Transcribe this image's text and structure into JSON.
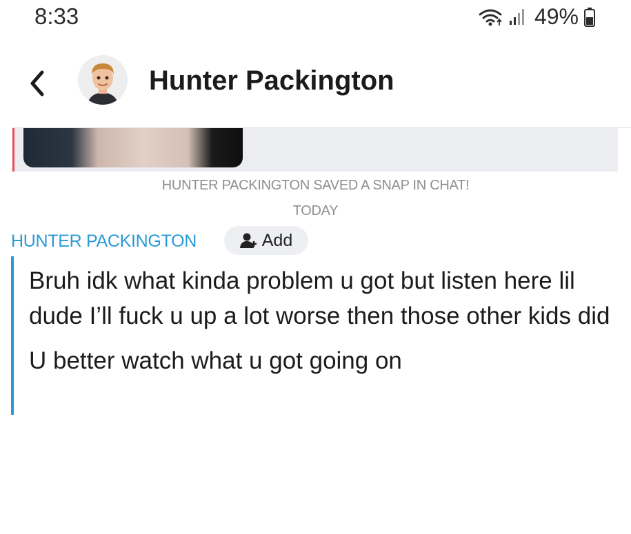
{
  "status_bar": {
    "time": "8:33",
    "battery": "49%",
    "icons": [
      "wifi-icon",
      "signal-icon",
      "battery-icon"
    ]
  },
  "header": {
    "back_icon": "chevron-left-icon",
    "contact_name": "Hunter Packington"
  },
  "chat": {
    "saved_notice": "HUNTER PACKINGTON SAVED A SNAP IN CHAT!",
    "date_separator": "TODAY",
    "sender_label": "HUNTER PACKINGTON",
    "add_button_label": "Add",
    "messages": [
      "Bruh idk what kinda problem u got but listen here lil dude I’ll fuck u up a lot worse then those other kids did",
      "U better watch what u got going on"
    ]
  },
  "colors": {
    "sender_accent": "#2a9ad6",
    "snap_accent": "#e84a5f",
    "system_text": "#8e8e93"
  }
}
